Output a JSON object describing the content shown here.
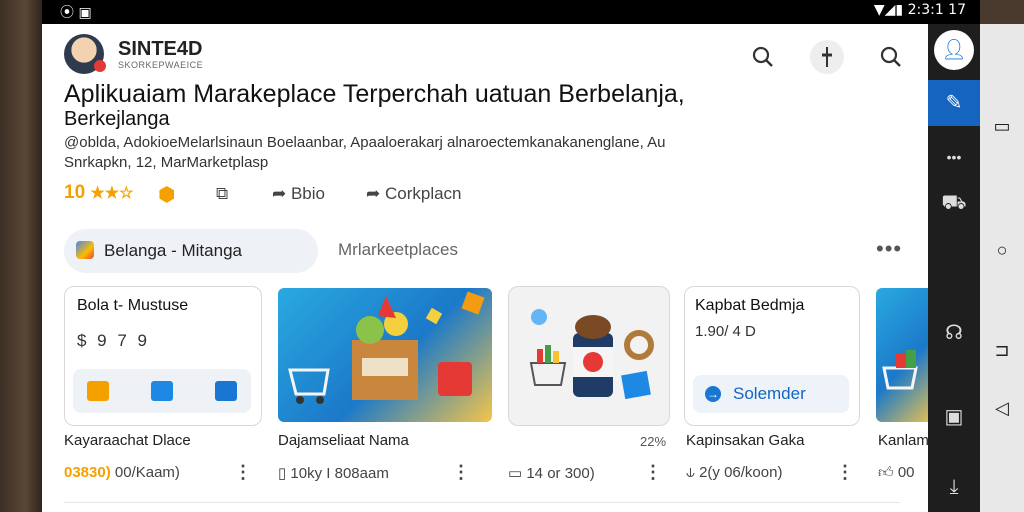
{
  "status": {
    "left": "⦿  ▣",
    "right": "▼◢▮ 2:3:1 17"
  },
  "header": {
    "brand": "SINTE4D",
    "brand_sub": "SKORKEPWAEICE",
    "title": "Aplikuaiam Marakeplace Terperchah uatuan Berbelanja,",
    "title2": "Berkejlanga",
    "desc": "@oblda, AdokioeMelarlsinaun Boelaanbar, Apaaloerakarj alnaroectemkanakanenglane, Au",
    "desc2": "Snrkapkn, 12, MarMarketplasp",
    "rating": "10",
    "actions": [
      "Bbio",
      "Corkplacn"
    ]
  },
  "tabs": {
    "active": "Belanga - Mitanga",
    "second": "Mrlarkeetplaces"
  },
  "cards": {
    "c1": {
      "title": "Bola t- Mustuse",
      "price": "$ 9 7 9"
    },
    "c4": {
      "title": "Kapbat Bedmja",
      "price": "1.90/ 4 D",
      "button": "Solemder"
    }
  },
  "captions": [
    "Kayaraachat Dlace",
    "Dajamseliaat Nama",
    "Kapinsakan Gaka",
    "Kanlam"
  ],
  "pct": "22%",
  "meta": {
    "m1_y": "03830)",
    "m1": " 00/Kaam)",
    "m2": "10ky I 808aam",
    "m3": "14 or 300)",
    "m4": "2(y 06/koon)",
    "m5": "00"
  }
}
